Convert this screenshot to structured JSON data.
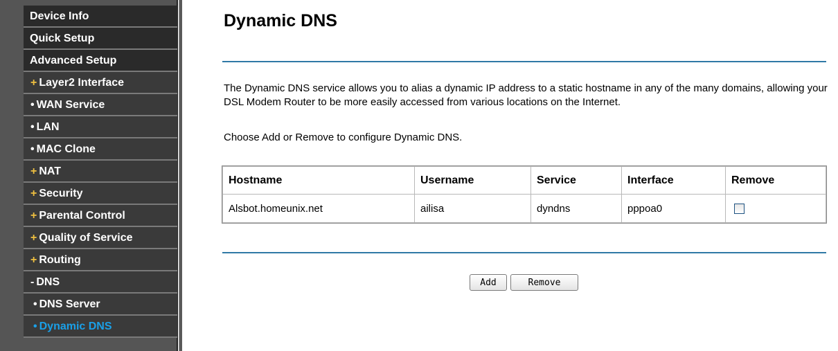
{
  "sidebar": {
    "items": [
      {
        "mark": "",
        "label": "Device Info"
      },
      {
        "mark": "",
        "label": "Quick Setup"
      },
      {
        "mark": "",
        "label": "Advanced Setup"
      },
      {
        "mark": "+",
        "label": "Layer2 Interface"
      },
      {
        "mark": "•",
        "label": "WAN Service"
      },
      {
        "mark": "•",
        "label": "LAN"
      },
      {
        "mark": "•",
        "label": "MAC Clone"
      },
      {
        "mark": "+",
        "label": "NAT"
      },
      {
        "mark": "+",
        "label": "Security"
      },
      {
        "mark": "+",
        "label": "Parental Control"
      },
      {
        "mark": "+",
        "label": "Quality of Service"
      },
      {
        "mark": "+",
        "label": "Routing"
      },
      {
        "mark": "-",
        "label": "DNS"
      },
      {
        "mark": "•",
        "label": "DNS Server"
      },
      {
        "mark": "•",
        "label": "Dynamic DNS"
      }
    ],
    "active": "Dynamic DNS"
  },
  "main": {
    "title": "Dynamic DNS",
    "description": "The Dynamic DNS service allows you to alias a dynamic IP address to a static hostname in any of the many domains, allowing your DSL Modem Router to be more easily accessed from various locations on the Internet.",
    "instruction": "Choose Add or Remove to configure Dynamic DNS.",
    "table": {
      "headers": [
        "Hostname",
        "Username",
        "Service",
        "Interface",
        "Remove"
      ],
      "rows": [
        {
          "hostname": "Alsbot.homeunix.net",
          "username": "ailisa",
          "service": "dyndns",
          "interface": "pppoa0",
          "remove_checked": false
        }
      ]
    },
    "buttons": {
      "add": "Add",
      "remove": "Remove"
    }
  },
  "colors": {
    "sidebar_bg": "#555555",
    "active_item": "#1aa0e8",
    "divider": "#2f79a6"
  }
}
